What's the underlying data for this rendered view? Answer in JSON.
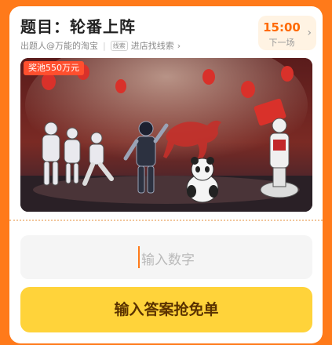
{
  "header": {
    "title": "题目：轮番上阵",
    "author": "出题人@万能的淘宝",
    "clue_tag": "线索",
    "clue_link": "进店找线索",
    "clue_chevron": "›"
  },
  "next_round": {
    "time": "15:00",
    "label": "下一场",
    "chevron": "›"
  },
  "hero": {
    "prize_badge": "奖池550万元"
  },
  "answer": {
    "placeholder": "输入数字"
  },
  "submit": {
    "label": "输入答案抢免单"
  },
  "colors": {
    "page_bg": "#ff7a1a",
    "accent": "#ff6a00",
    "button": "#ffd33a",
    "badge": "#ff4f2e"
  }
}
